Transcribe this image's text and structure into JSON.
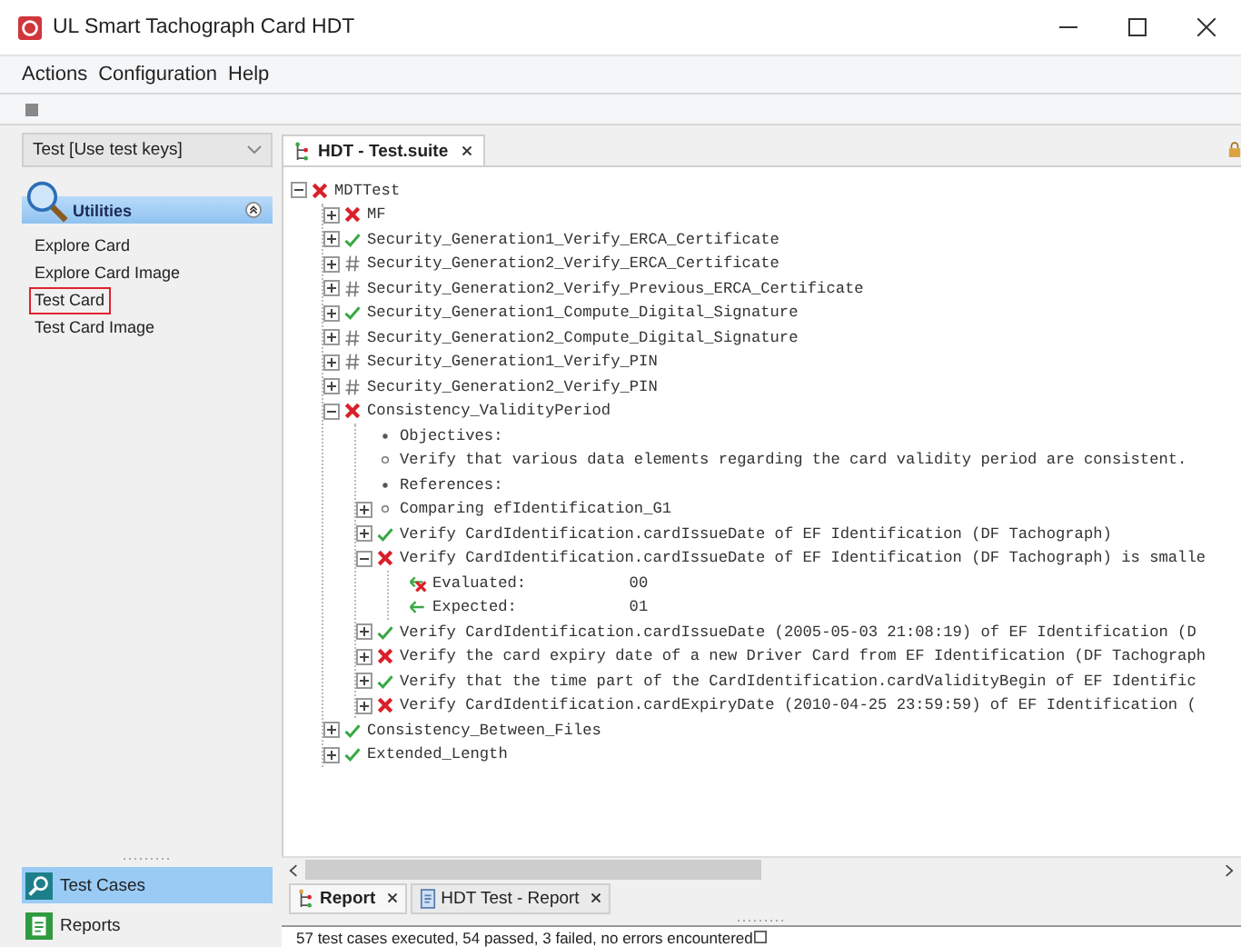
{
  "window": {
    "title": "UL Smart Tachograph Card HDT"
  },
  "menu": [
    "Actions",
    "Configuration",
    "Help"
  ],
  "sidebar": {
    "profile": "Test [Use test keys]",
    "section": {
      "title": "Utilities",
      "expanded": true
    },
    "items": [
      {
        "label": "Explore Card",
        "selected": false
      },
      {
        "label": "Explore Card Image",
        "selected": false
      },
      {
        "label": "Test Card",
        "selected": true
      },
      {
        "label": "Test Card Image",
        "selected": false
      }
    ],
    "nav": [
      {
        "label": "Test Cases",
        "selected": true,
        "kind": "test-cases"
      },
      {
        "label": "Reports",
        "selected": false,
        "kind": "reports"
      }
    ]
  },
  "editor_tab": {
    "label": "HDT - Test.suite",
    "selected": true
  },
  "tree": [
    {
      "label": "MDTTest",
      "kind": "fail",
      "expanded": true,
      "children": [
        {
          "label": "MF",
          "kind": "fail",
          "expanded": false
        },
        {
          "label": "Security_Generation1_Verify_ERCA_Certificate",
          "kind": "pass",
          "expanded": false
        },
        {
          "label": "Security_Generation2_Verify_ERCA_Certificate",
          "kind": "skipped",
          "expanded": false
        },
        {
          "label": "Security_Generation2_Verify_Previous_ERCA_Certificate",
          "kind": "skipped",
          "expanded": false
        },
        {
          "label": "Security_Generation1_Compute_Digital_Signature",
          "kind": "pass",
          "expanded": false
        },
        {
          "label": "Security_Generation2_Compute_Digital_Signature",
          "kind": "skipped",
          "expanded": false
        },
        {
          "label": "Security_Generation1_Verify_PIN",
          "kind": "skipped",
          "expanded": false
        },
        {
          "label": "Security_Generation2_Verify_PIN",
          "kind": "skipped",
          "expanded": false
        },
        {
          "label": "Consistency_ValidityPeriod",
          "kind": "fail",
          "expanded": true,
          "children": [
            {
              "label": "Objectives:",
              "kind": "bullet"
            },
            {
              "label": "Verify that various data elements regarding the card validity period are consistent.",
              "kind": "circle"
            },
            {
              "label": "References:",
              "kind": "bullet"
            },
            {
              "label": "Comparing efIdentification_G1",
              "kind": "circle",
              "expanded": false
            },
            {
              "label": "Verify CardIdentification.cardIssueDate of EF Identification (DF Tachograph)",
              "kind": "pass",
              "expanded": false
            },
            {
              "label": "Verify CardIdentification.cardIssueDate of EF Identification (DF Tachograph) is smalle",
              "kind": "fail",
              "expanded": true,
              "children": [
                {
                  "label": "Evaluated:",
                  "value": "00",
                  "kind": "evaluated"
                },
                {
                  "label": "Expected:",
                  "value": "01",
                  "kind": "expected"
                }
              ]
            },
            {
              "label": "Verify CardIdentification.cardIssueDate (2005-05-03 21:08:19) of EF Identification (D",
              "kind": "pass",
              "expanded": false
            },
            {
              "label": "Verify the card expiry date of a new Driver Card from EF Identification (DF Tachograph",
              "kind": "fail",
              "expanded": false
            },
            {
              "label": "Verify that the time part of the CardIdentification.cardValidityBegin of EF Identific",
              "kind": "pass",
              "expanded": false
            },
            {
              "label": "Verify CardIdentification.cardExpiryDate (2010-04-25 23:59:59) of EF Identification (",
              "kind": "fail",
              "expanded": false
            }
          ]
        },
        {
          "label": "Consistency_Between_Files",
          "kind": "pass",
          "expanded": false
        },
        {
          "label": "Extended_Length",
          "kind": "pass",
          "expanded": false
        }
      ]
    }
  ],
  "bottom_tabs": [
    {
      "label": "Report",
      "selected": true,
      "kind": "tree"
    },
    {
      "label": "HDT Test - Report",
      "selected": false,
      "kind": "document"
    }
  ],
  "status_bar": "57 test cases executed, 54 passed, 3 failed, no errors encountered"
}
